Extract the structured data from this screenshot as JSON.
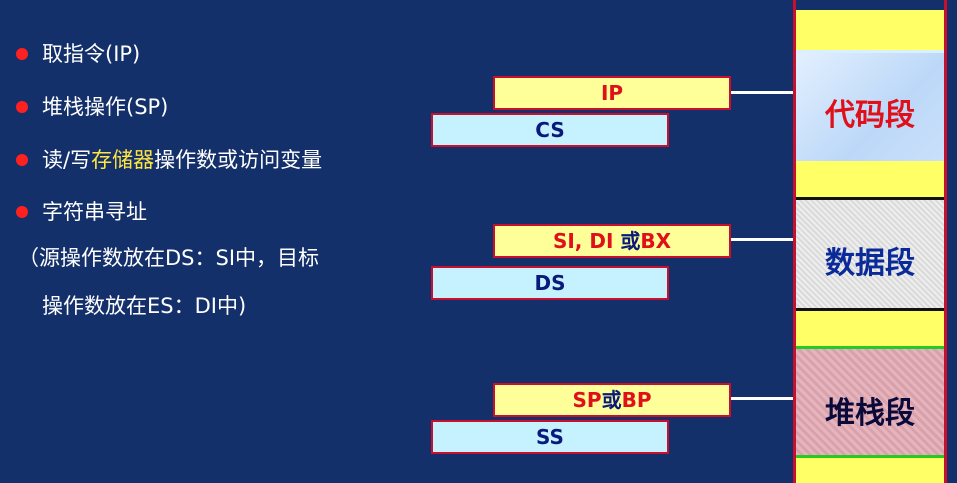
{
  "bullets": [
    {
      "text": "取指令(IP)"
    },
    {
      "text": "堆栈操作(SP)"
    },
    {
      "pre": "读/写",
      "highlight": "存储器",
      "post": "操作数或访问变量"
    },
    {
      "text": "字符串寻址"
    }
  ],
  "note": {
    "line1": "（源操作数放在DS：SI中，目标",
    "line2": "操作数放在ES：DI中)"
  },
  "groups": [
    {
      "top": {
        "part1": "IP",
        "part2": "",
        "part3": ""
      },
      "base": "CS"
    },
    {
      "top": {
        "part1": "SI, DI",
        "part2": " 或",
        "part3": "BX"
      },
      "base": "DS"
    },
    {
      "top": {
        "part1": "SP",
        "part2": "或",
        "part3": "BP"
      },
      "base": "SS"
    }
  ],
  "memory": {
    "code_label": "代码段",
    "data_label": "数据段",
    "stack_label": "堆栈段"
  },
  "colors": {
    "background": "#14306a",
    "bullet_dot": "#ff2020",
    "highlight": "#ffe640",
    "register_top": "#ffff99",
    "register_base": "#c6f2ff",
    "memory_border": "#c8102e",
    "code_segment_label": "#e0101a",
    "data_segment_label": "#0a2a9a",
    "stack_segment_label": "#0a0a3a"
  }
}
